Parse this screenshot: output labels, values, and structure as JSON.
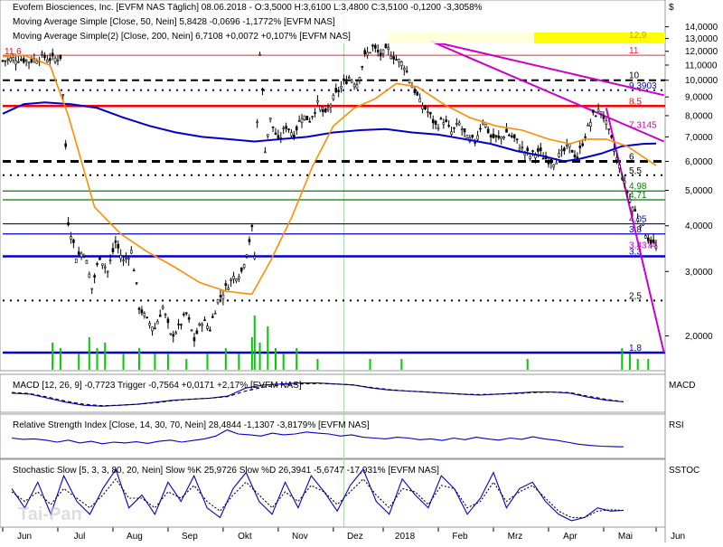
{
  "chart_data": [
    {
      "type": "candlestick",
      "panel": "price",
      "header": {
        "title": "Evofem Biosciences, Inc. [EVFM NAS  Täglich] 08.06.2018 - O:3,5000 H:3,6100 L:3,4800 C:3,5100 -0,1200 -3,3058%",
        "ma50": "Moving Average Simple [Close, 50, Nein] 5,8428 -0,0696 -1,1772% [EVFM NAS]",
        "ma200": "Moving Average Simple(2) [Close, 200, Nein] 6,7108 +0,0072 +0,107% [EVFM NAS]"
      },
      "currency_symbol": "$",
      "scale": "log",
      "ylim": [
        1.75,
        15.3
      ],
      "ytick_values": [
        2,
        3,
        4,
        5,
        6,
        7,
        8,
        9,
        10,
        11,
        12,
        13,
        14
      ],
      "ytick_labels": [
        "2,0000",
        "3,0000",
        "4,0000",
        "5,0000",
        "6,0000",
        "7,0000",
        "8,0000",
        "9,0000",
        "10,0000",
        "11,0000",
        "12,0000",
        "13,0000",
        "14,0000"
      ],
      "x_labels": [
        "Jun",
        "Jul",
        "Aug",
        "Sep",
        "Okt",
        "Nov",
        "Dez",
        "2018",
        "Feb",
        "Mrz",
        "Apr",
        "Mai",
        "Jun"
      ],
      "price_path": [
        [
          0,
          11.3
        ],
        [
          5,
          11.5
        ],
        [
          10,
          11.3
        ],
        [
          15,
          11.6
        ],
        [
          19,
          11.4
        ],
        [
          22,
          11.6
        ],
        [
          25,
          4.1
        ],
        [
          28,
          3.3
        ],
        [
          31,
          3.4
        ],
        [
          34,
          2.7
        ],
        [
          37,
          3.3
        ],
        [
          40,
          3.0
        ],
        [
          43,
          3.6
        ],
        [
          46,
          3.2
        ],
        [
          49,
          3.4
        ],
        [
          52,
          2.4
        ],
        [
          55,
          2.2
        ],
        [
          58,
          2.1
        ],
        [
          61,
          2.4
        ],
        [
          64,
          2.0
        ],
        [
          67,
          2.1
        ],
        [
          70,
          2.3
        ],
        [
          73,
          1.95
        ],
        [
          76,
          2.2
        ],
        [
          79,
          2.1
        ],
        [
          82,
          2.5
        ],
        [
          85,
          2.7
        ],
        [
          88,
          2.9
        ],
        [
          91,
          3.0
        ],
        [
          93,
          3.4
        ],
        [
          95,
          3.9
        ],
        [
          96,
          3.3
        ],
        [
          98,
          12.0
        ],
        [
          100,
          6.5
        ],
        [
          102,
          7.8
        ],
        [
          105,
          6.8
        ],
        [
          108,
          7.5
        ],
        [
          111,
          7.1
        ],
        [
          114,
          8.0
        ],
        [
          117,
          7.8
        ],
        [
          120,
          8.6
        ],
        [
          123,
          8.0
        ],
        [
          126,
          8.9
        ],
        [
          129,
          9.6
        ],
        [
          132,
          10.2
        ],
        [
          135,
          9.8
        ],
        [
          138,
          11.6
        ],
        [
          141,
          12.3
        ],
        [
          144,
          11.7
        ],
        [
          147,
          12.1
        ],
        [
          150,
          11.4
        ],
        [
          153,
          11.0
        ],
        [
          156,
          9.7
        ],
        [
          159,
          8.7
        ],
        [
          162,
          8.2
        ],
        [
          165,
          7.5
        ],
        [
          168,
          7.8
        ],
        [
          171,
          7.2
        ],
        [
          174,
          7.6
        ],
        [
          177,
          6.9
        ],
        [
          180,
          6.8
        ],
        [
          183,
          7.8
        ],
        [
          186,
          7.0
        ],
        [
          189,
          6.9
        ],
        [
          192,
          7.2
        ],
        [
          195,
          6.9
        ],
        [
          198,
          6.5
        ],
        [
          201,
          6.2
        ],
        [
          204,
          6.4
        ],
        [
          207,
          6.1
        ],
        [
          210,
          6.0
        ],
        [
          213,
          6.3
        ],
        [
          216,
          6.6
        ],
        [
          219,
          6.1
        ],
        [
          222,
          7.1
        ],
        [
          225,
          8.0
        ],
        [
          228,
          8.3
        ],
        [
          231,
          7.2
        ],
        [
          234,
          6.1
        ],
        [
          237,
          5.2
        ],
        [
          240,
          4.5
        ],
        [
          243,
          4.1
        ],
        [
          246,
          3.7
        ],
        [
          249,
          3.5
        ]
      ],
      "ma50_path": [
        [
          0,
          11.6
        ],
        [
          8,
          11.7
        ],
        [
          18,
          11.0
        ],
        [
          25,
          8.0
        ],
        [
          35,
          4.5
        ],
        [
          45,
          3.8
        ],
        [
          55,
          3.4
        ],
        [
          65,
          3.1
        ],
        [
          75,
          2.8
        ],
        [
          85,
          2.65
        ],
        [
          95,
          2.6
        ],
        [
          102,
          3.2
        ],
        [
          110,
          4.2
        ],
        [
          118,
          5.8
        ],
        [
          126,
          7.5
        ],
        [
          134,
          8.4
        ],
        [
          142,
          8.9
        ],
        [
          150,
          9.8
        ],
        [
          158,
          9.6
        ],
        [
          168,
          8.6
        ],
        [
          178,
          7.9
        ],
        [
          188,
          7.5
        ],
        [
          198,
          7.3
        ],
        [
          208,
          6.9
        ],
        [
          216,
          6.7
        ],
        [
          222,
          6.9
        ],
        [
          230,
          6.9
        ],
        [
          238,
          6.6
        ],
        [
          249,
          5.84
        ]
      ],
      "ma200_path": [
        [
          0,
          8.1
        ],
        [
          8,
          8.6
        ],
        [
          16,
          8.7
        ],
        [
          26,
          8.6
        ],
        [
          36,
          8.4
        ],
        [
          46,
          7.9
        ],
        [
          56,
          7.5
        ],
        [
          66,
          7.2
        ],
        [
          76,
          7.0
        ],
        [
          86,
          6.9
        ],
        [
          96,
          6.8
        ],
        [
          106,
          6.9
        ],
        [
          116,
          7.0
        ],
        [
          126,
          7.2
        ],
        [
          136,
          7.3
        ],
        [
          146,
          7.35
        ],
        [
          156,
          7.2
        ],
        [
          166,
          7.1
        ],
        [
          176,
          6.9
        ],
        [
          186,
          6.7
        ],
        [
          196,
          6.4
        ],
        [
          206,
          6.2
        ],
        [
          214,
          6.0
        ],
        [
          220,
          6.1
        ],
        [
          228,
          6.3
        ],
        [
          236,
          6.6
        ],
        [
          244,
          6.7
        ],
        [
          249,
          6.71
        ]
      ],
      "volume_bars": [
        [
          19,
          0.5
        ],
        [
          22,
          0.4
        ],
        [
          29,
          0.3
        ],
        [
          33,
          0.6
        ],
        [
          36,
          0.4
        ],
        [
          39,
          0.5
        ],
        [
          46,
          0.3
        ],
        [
          52,
          0.4
        ],
        [
          58,
          0.3
        ],
        [
          63,
          0.3
        ],
        [
          70,
          0.2
        ],
        [
          78,
          0.3
        ],
        [
          85,
          0.4
        ],
        [
          90,
          0.3
        ],
        [
          95,
          0.6
        ],
        [
          96,
          1.0
        ],
        [
          98,
          0.5
        ],
        [
          101,
          0.8
        ],
        [
          104,
          0.4
        ],
        [
          107,
          0.3
        ],
        [
          112,
          0.4
        ],
        [
          120,
          0.2
        ],
        [
          140,
          0.2
        ],
        [
          152,
          0.2
        ],
        [
          200,
          0.2
        ],
        [
          236,
          0.4
        ],
        [
          239,
          0.3
        ],
        [
          242,
          0.2
        ],
        [
          246,
          0.2
        ]
      ],
      "horizontal_levels": [
        {
          "value": 12.9,
          "label": "12,9",
          "color": "#ffff00",
          "style": "band"
        },
        {
          "value": 11.7,
          "label": "11",
          "color": "#ff2020",
          "style": "solid-thin"
        },
        {
          "value": 10.0,
          "label": "10",
          "color": "#000000",
          "style": "dashed"
        },
        {
          "value": 9.3903,
          "label": "9,3903",
          "color": "#0000cc",
          "style": "dotted"
        },
        {
          "value": 8.5,
          "label": "8,5",
          "color": "#ff0000",
          "style": "solid-thick"
        },
        {
          "value": 7.3145,
          "label": "7,3145",
          "color": "#cc00cc",
          "style": "none"
        },
        {
          "value": 6.0,
          "label": "6",
          "color": "#000000",
          "style": "dashed-thick"
        },
        {
          "value": 5.5,
          "label": "5,5",
          "color": "#000000",
          "style": "dotted"
        },
        {
          "value": 4.98,
          "label": "4,98",
          "color": "#008000",
          "style": "solid"
        },
        {
          "value": 4.71,
          "label": "4,71",
          "color": "#008000",
          "style": "solid"
        },
        {
          "value": 4.05,
          "label": "4,05",
          "color": "#0000cc",
          "style": "solid"
        },
        {
          "value": 3.8,
          "label": "3,8",
          "color": "#0000cc",
          "style": "solid"
        },
        {
          "value": 3.4374,
          "label": "3,4374",
          "color": "#cc00cc",
          "style": "none"
        },
        {
          "value": 3.3,
          "label": "3,3",
          "color": "#0000cc",
          "style": "solid-thick"
        },
        {
          "value": 2.5,
          "label": "2,5",
          "color": "#000000",
          "style": "dotted"
        },
        {
          "value": 1.8,
          "label": "1,8",
          "color": "#0000cc",
          "style": "solid-thick"
        }
      ],
      "trendlines": [
        {
          "from": [
            163,
            12.8
          ],
          "to": [
            252,
            9.1
          ],
          "color": "#cc00cc"
        },
        {
          "from": [
            163,
            12.8
          ],
          "to": [
            252,
            6.8
          ],
          "color": "#cc00cc"
        },
        {
          "from": [
            230,
            8.4
          ],
          "to": [
            252,
            1.8
          ],
          "color": "#cc00cc"
        }
      ],
      "annotations": [
        {
          "text": "11,6",
          "x": 0,
          "y": 11.7,
          "color": "#ff0000"
        }
      ],
      "colors": {
        "ma50": "#ff8c00",
        "ma200": "#0000cc",
        "candle": "#000000",
        "volume": "#00cc00"
      }
    },
    {
      "type": "line",
      "panel": "macd",
      "header": "MACD [12, 26, 9] -0,7723 Trigger -0,7564 +0,0171 +2,17% [EVFM NAS]",
      "label": "MACD",
      "series": [
        {
          "color": "#0000cc",
          "values": [
            0.1,
            0.0,
            -0.4,
            -0.8,
            -1.1,
            -1.2,
            -1.1,
            -1.0,
            -0.8,
            -0.6,
            -0.5,
            -0.4,
            -0.2,
            0.6,
            0.9,
            1.0,
            1.1,
            1.1,
            1.0,
            0.9,
            0.6,
            0.4,
            0.3,
            0.2,
            0.1,
            0.0,
            -0.1,
            0.0,
            0.1,
            0.2,
            0.2,
            0.1,
            -0.3,
            -0.6,
            -0.77
          ]
        },
        {
          "color": "#000000",
          "style": "dashed",
          "values": [
            0.15,
            0.05,
            -0.3,
            -0.7,
            -1.0,
            -1.15,
            -1.1,
            -1.0,
            -0.85,
            -0.65,
            -0.5,
            -0.4,
            -0.25,
            0.3,
            0.7,
            0.9,
            1.0,
            1.05,
            1.0,
            0.9,
            0.65,
            0.45,
            0.3,
            0.2,
            0.1,
            0.0,
            -0.05,
            0.0,
            0.05,
            0.15,
            0.2,
            0.15,
            -0.2,
            -0.5,
            -0.76
          ]
        }
      ],
      "ylim": [
        -1.8,
        1.6
      ]
    },
    {
      "type": "line",
      "panel": "rsi",
      "header": "Relative Strength Index [Close, 14, 30, 70, Nein] 28,4844 -1,1307 -3,8179% [EVFM NAS]",
      "label": "RSI",
      "series": [
        {
          "color": "#0000cc",
          "values": [
            50,
            47,
            48,
            45,
            40,
            45,
            38,
            42,
            36,
            40,
            38,
            41,
            37,
            42,
            45,
            40,
            44,
            48,
            55,
            70,
            60,
            58,
            55,
            62,
            58,
            60,
            65,
            62,
            60,
            55,
            58,
            52,
            50,
            48,
            52,
            50,
            46,
            48,
            44,
            50,
            46,
            52,
            48,
            45,
            50,
            47,
            53,
            48,
            45,
            40,
            35,
            32,
            30,
            29,
            28.5
          ]
        }
      ],
      "ylim": [
        0,
        100
      ]
    },
    {
      "type": "line",
      "panel": "stochastic",
      "header": "Stochastic Slow [5, 3, 3, 80, 20, Nein] Slow %K 25,9726 Slow %D 26,3941 -5,6747 -17,931% [EVFM NAS]",
      "label": "SSTOC",
      "series": [
        {
          "color": "#0000cc",
          "values": [
            60,
            30,
            70,
            20,
            80,
            40,
            20,
            60,
            90,
            30,
            50,
            20,
            70,
            40,
            80,
            30,
            15,
            60,
            85,
            40,
            20,
            70,
            30,
            80,
            55,
            25,
            65,
            90,
            40,
            20,
            75,
            50,
            30,
            80,
            60,
            20,
            45,
            85,
            30,
            60,
            70,
            40,
            20,
            10,
            15,
            30,
            25,
            26
          ]
        },
        {
          "color": "#000000",
          "style": "dotted",
          "values": [
            55,
            40,
            55,
            35,
            60,
            45,
            30,
            50,
            75,
            45,
            45,
            30,
            55,
            45,
            65,
            40,
            25,
            50,
            70,
            50,
            30,
            55,
            40,
            65,
            55,
            35,
            55,
            75,
            50,
            30,
            60,
            55,
            35,
            65,
            60,
            30,
            40,
            70,
            40,
            55,
            65,
            45,
            25,
            15,
            15,
            25,
            27,
            26
          ]
        }
      ],
      "ylim": [
        0,
        100
      ]
    }
  ],
  "watermark": "Tai-Pan"
}
